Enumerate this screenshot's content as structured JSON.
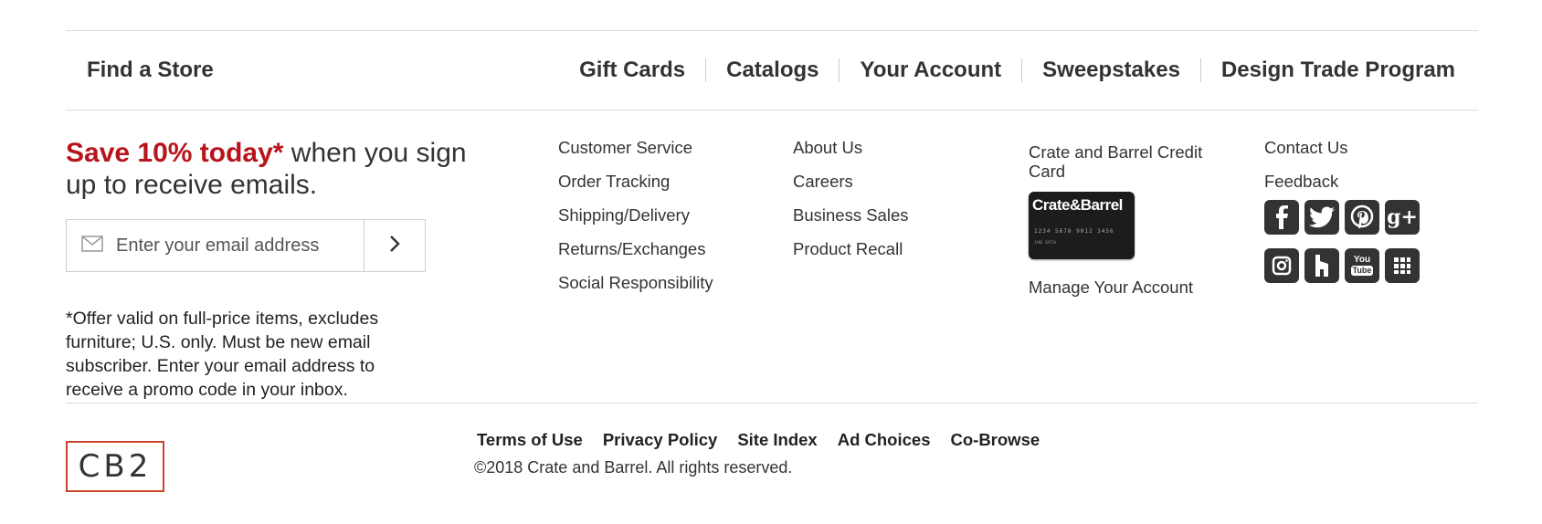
{
  "top_nav": {
    "find_store": "Find a Store",
    "links": [
      "Gift Cards",
      "Catalogs",
      "Your Account",
      "Sweepstakes",
      "Design Trade Program"
    ]
  },
  "signup": {
    "headline_emphasis": "Save 10% today*",
    "headline_rest": " when you sign up to receive emails.",
    "email_placeholder": "Enter your email address",
    "disclaimer": "*Offer valid on full-price items, excludes furniture; U.S. only. Must be new email subscriber. Enter your email address to receive a promo code in your inbox."
  },
  "columns": {
    "customer": [
      "Customer Service",
      "Order Tracking",
      "Shipping/Delivery",
      "Returns/Exchanges",
      "Social Responsibility"
    ],
    "company": [
      "About Us",
      "Careers",
      "Business Sales",
      "Product Recall"
    ],
    "credit_card": {
      "title": "Crate and Barrel Credit Card",
      "card_brand": "Crate&Barrel",
      "card_number": "1234 5678 9012 3456",
      "card_name": "JANE SMITH",
      "manage": "Manage Your Account"
    },
    "contact": [
      "Contact Us",
      "Feedback"
    ]
  },
  "social_icons": [
    "facebook-icon",
    "twitter-icon",
    "pinterest-icon",
    "google-plus-icon",
    "instagram-icon",
    "houzz-icon",
    "youtube-icon",
    "grid-app-icon"
  ],
  "social_labels": {
    "google_plus": "g+",
    "youtube_top": "You",
    "youtube_bottom": "Tube"
  },
  "legal_links": [
    "Terms of Use",
    "Privacy Policy",
    "Site Index",
    "Ad Choices",
    "Co-Browse"
  ],
  "copyright": "©2018 Crate and Barrel. All rights reserved.",
  "logo_text": "CB2",
  "colors": {
    "accent_red": "#b8141c",
    "logo_border": "#c8452a",
    "icon_bg": "#333333"
  }
}
